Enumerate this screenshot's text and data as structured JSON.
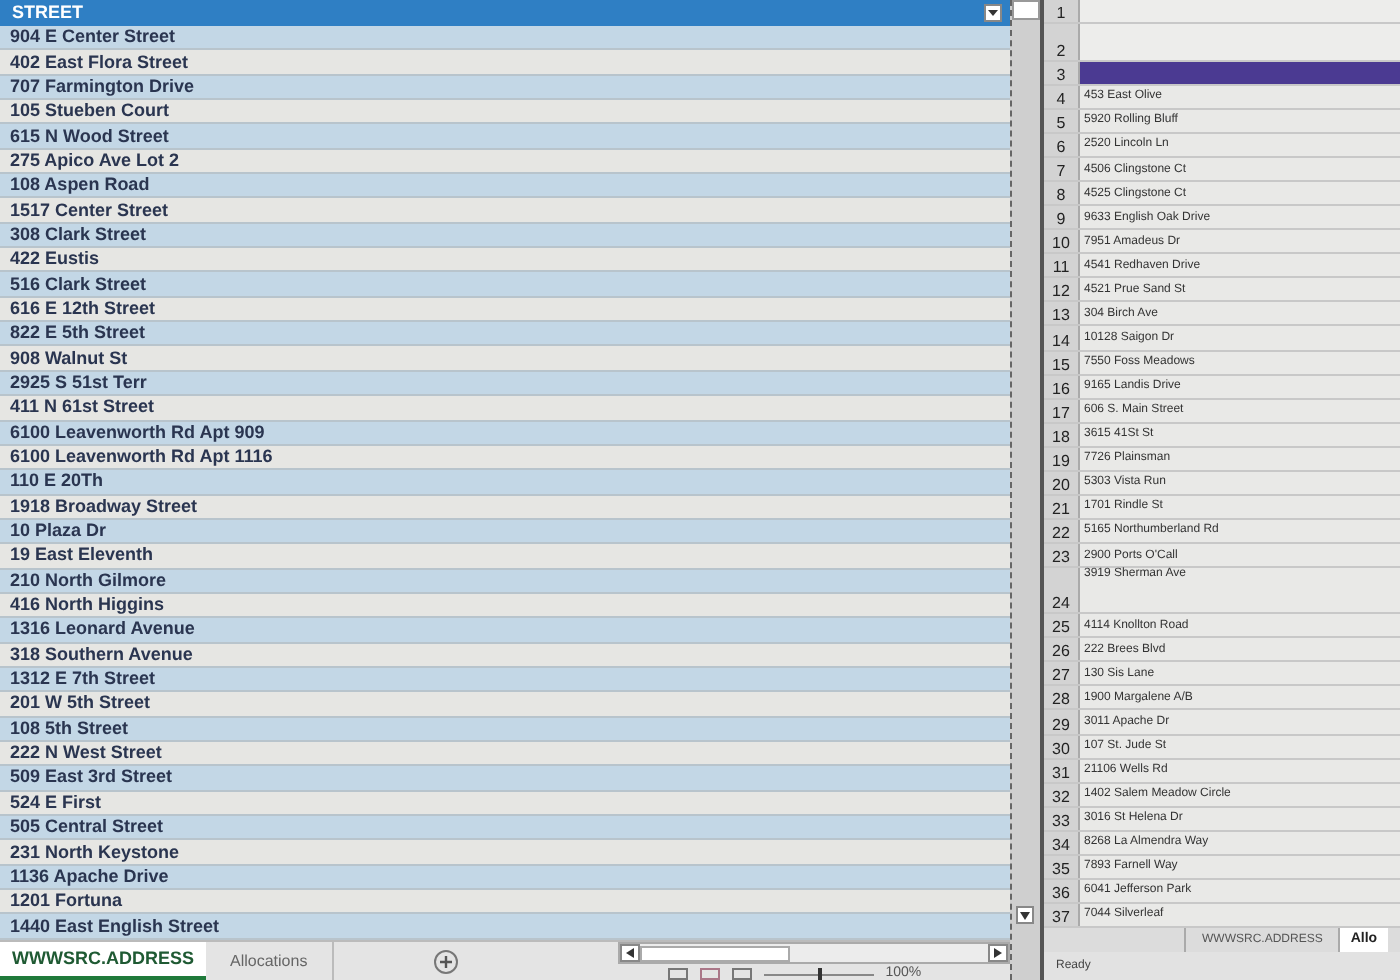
{
  "left_sheet": {
    "column": {
      "label": "STREET",
      "filter": true
    },
    "rows": [
      "904 E Center Street",
      "402 East Flora Street",
      "707 Farmington Drive",
      "105 Stueben Court",
      "615 N Wood Street",
      "275 Apico Ave Lot 2",
      "108 Aspen Road",
      "1517 Center Street",
      "308 Clark Street",
      "422 Eustis",
      "516 Clark Street",
      "616 E 12th Street",
      "822 E 5th Street",
      "908 Walnut St",
      "2925 S 51st Terr",
      "411 N 61st Street",
      "6100 Leavenworth Rd Apt 909",
      "6100 Leavenworth Rd Apt 1116",
      "110 E 20Th",
      "1918 Broadway Street",
      "10 Plaza Dr",
      "19 East Eleventh",
      "210 North Gilmore",
      "416 North Higgins",
      "1316 Leonard Avenue",
      "318 Southern Avenue",
      "1312 E 7th Street",
      "201 W 5th Street",
      "108 5th Street",
      "222 N West Street",
      "509 East 3rd Street",
      "524 E First",
      "505 Central Street",
      "231 North Keystone",
      "1136 Apache Drive",
      "1201 Fortuna",
      "1440 East English Street"
    ],
    "sheet_tabs": [
      {
        "label": "WWWSRC.ADDRESS",
        "selected": true
      },
      {
        "label": "Allocations",
        "selected": false
      }
    ],
    "zoom_slider": {
      "level": 0.5
    },
    "zoom": "100%"
  },
  "right_sheet": {
    "rows": [
      {
        "number": "1",
        "kind": "blank"
      },
      {
        "number": "2",
        "kind": "tall"
      },
      {
        "number": "3",
        "kind": "band"
      },
      {
        "number": "4",
        "kind": "cell",
        "text": "453 East Olive"
      },
      {
        "number": "5",
        "kind": "cell",
        "text": "5920 Rolling Bluff"
      },
      {
        "number": "6",
        "kind": "cell",
        "text": "2520 Lincoln Ln"
      },
      {
        "number": "7",
        "kind": "cell",
        "text": "4506 Clingstone Ct"
      },
      {
        "number": "8",
        "kind": "cell",
        "text": "4525 Clingstone Ct"
      },
      {
        "number": "9",
        "kind": "cell",
        "text": "9633 English Oak Drive"
      },
      {
        "number": "10",
        "kind": "cell",
        "text": "7951 Amadeus Dr"
      },
      {
        "number": "11",
        "kind": "cell",
        "text": "4541 Redhaven Drive"
      },
      {
        "number": "12",
        "kind": "cell",
        "text": "4521 Prue Sand St"
      },
      {
        "number": "13",
        "kind": "cell",
        "text": "304 Birch Ave"
      },
      {
        "number": "14",
        "kind": "cell",
        "text": "10128 Saigon Dr"
      },
      {
        "number": "15",
        "kind": "cell",
        "text": "7550 Foss Meadows"
      },
      {
        "number": "16",
        "kind": "cell",
        "text": "9165 Landis Drive"
      },
      {
        "number": "17",
        "kind": "cell",
        "text": "606 S. Main Street"
      },
      {
        "number": "18",
        "kind": "cell",
        "text": "3615 41St St"
      },
      {
        "number": "19",
        "kind": "cell",
        "text": "7726 Plainsman"
      },
      {
        "number": "20",
        "kind": "cell",
        "text": "5303 Vista Run"
      },
      {
        "number": "21",
        "kind": "cell",
        "text": "1701 Rindle St"
      },
      {
        "number": "22",
        "kind": "cell",
        "text": "5165 Northumberland Rd"
      },
      {
        "number": "23",
        "kind": "cell",
        "text": "2900 Ports O'Call"
      },
      {
        "number": "24",
        "kind": "tallcell",
        "text": "3919 Sherman Ave"
      },
      {
        "number": "25",
        "kind": "cell",
        "text": "4114 Knollton Road"
      },
      {
        "number": "26",
        "kind": "cell",
        "text": "222 Brees Blvd"
      },
      {
        "number": "27",
        "kind": "cell",
        "text": "130 Sis Lane"
      },
      {
        "number": "28",
        "kind": "cell",
        "text": "1900 Margalene A/B"
      },
      {
        "number": "29",
        "kind": "cell",
        "text": "3011 Apache Dr"
      },
      {
        "number": "30",
        "kind": "cell",
        "text": "107 St. Jude St"
      },
      {
        "number": "31",
        "kind": "cell",
        "text": "21106 Wells Rd"
      },
      {
        "number": "32",
        "kind": "cell",
        "text": "1402 Salem Meadow Circle"
      },
      {
        "number": "33",
        "kind": "cell",
        "text": "3016 St Helena Dr"
      },
      {
        "number": "34",
        "kind": "cell",
        "text": "8268 La Almendra Way"
      },
      {
        "number": "35",
        "kind": "cell",
        "text": "7893 Farnell Way"
      },
      {
        "number": "36",
        "kind": "cell",
        "text": "6041 Jefferson Park"
      },
      {
        "number": "37",
        "kind": "cell",
        "text": "7044 Silverleaf"
      }
    ],
    "sheet_tabs": [
      {
        "label": "WWWSRC.ADDRESS",
        "selected": false
      },
      {
        "label": "Allo",
        "selected": true
      }
    ],
    "status": "Ready"
  }
}
